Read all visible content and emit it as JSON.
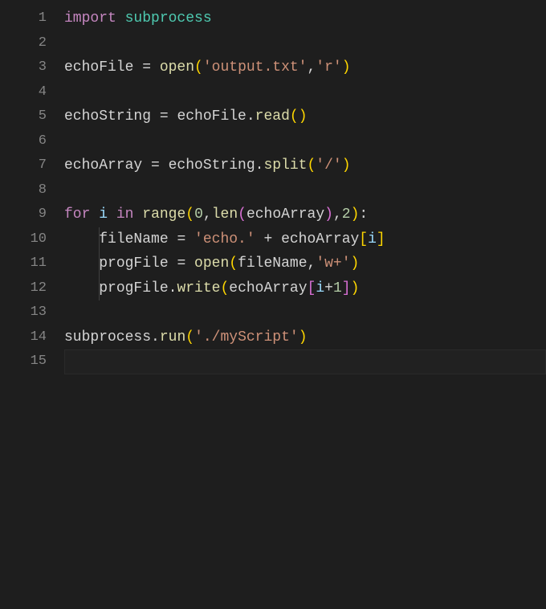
{
  "editor": {
    "language": "python",
    "current_line": 15,
    "lines": [
      {
        "num": 1,
        "indent": 0,
        "tokens": [
          {
            "t": "import ",
            "c": "tk-kw"
          },
          {
            "t": "subprocess",
            "c": "tk-mod"
          }
        ]
      },
      {
        "num": 2,
        "indent": 0,
        "tokens": []
      },
      {
        "num": 3,
        "indent": 0,
        "tokens": [
          {
            "t": "echoFile",
            "c": "tk-ident"
          },
          {
            "t": " = ",
            "c": "tk-op"
          },
          {
            "t": "open",
            "c": "tk-builtin"
          },
          {
            "t": "(",
            "c": "tk-par"
          },
          {
            "t": "'output.txt'",
            "c": "tk-str"
          },
          {
            "t": ",",
            "c": "tk-punc"
          },
          {
            "t": "'r'",
            "c": "tk-str"
          },
          {
            "t": ")",
            "c": "tk-par"
          }
        ]
      },
      {
        "num": 4,
        "indent": 0,
        "tokens": []
      },
      {
        "num": 5,
        "indent": 0,
        "tokens": [
          {
            "t": "echoString",
            "c": "tk-ident"
          },
          {
            "t": " = ",
            "c": "tk-op"
          },
          {
            "t": "echoFile",
            "c": "tk-ident"
          },
          {
            "t": ".",
            "c": "tk-op"
          },
          {
            "t": "read",
            "c": "tk-func"
          },
          {
            "t": "(",
            "c": "tk-par"
          },
          {
            "t": ")",
            "c": "tk-par"
          }
        ]
      },
      {
        "num": 6,
        "indent": 0,
        "tokens": []
      },
      {
        "num": 7,
        "indent": 0,
        "tokens": [
          {
            "t": "echoArray",
            "c": "tk-ident"
          },
          {
            "t": " = ",
            "c": "tk-op"
          },
          {
            "t": "echoString",
            "c": "tk-ident"
          },
          {
            "t": ".",
            "c": "tk-op"
          },
          {
            "t": "split",
            "c": "tk-func"
          },
          {
            "t": "(",
            "c": "tk-par"
          },
          {
            "t": "'/'",
            "c": "tk-str"
          },
          {
            "t": ")",
            "c": "tk-par"
          }
        ]
      },
      {
        "num": 8,
        "indent": 0,
        "tokens": []
      },
      {
        "num": 9,
        "indent": 0,
        "tokens": [
          {
            "t": "for",
            "c": "tk-kw"
          },
          {
            "t": " ",
            "c": "tk-op"
          },
          {
            "t": "i",
            "c": "tk-var"
          },
          {
            "t": " ",
            "c": "tk-op"
          },
          {
            "t": "in",
            "c": "tk-kw"
          },
          {
            "t": " ",
            "c": "tk-op"
          },
          {
            "t": "range",
            "c": "tk-builtin"
          },
          {
            "t": "(",
            "c": "tk-par"
          },
          {
            "t": "0",
            "c": "tk-num"
          },
          {
            "t": ",",
            "c": "tk-punc"
          },
          {
            "t": "len",
            "c": "tk-builtin"
          },
          {
            "t": "(",
            "c": "tk-par2"
          },
          {
            "t": "echoArray",
            "c": "tk-ident"
          },
          {
            "t": ")",
            "c": "tk-par2"
          },
          {
            "t": ",",
            "c": "tk-punc"
          },
          {
            "t": "2",
            "c": "tk-num"
          },
          {
            "t": ")",
            "c": "tk-par"
          },
          {
            "t": ":",
            "c": "tk-punc"
          }
        ]
      },
      {
        "num": 10,
        "indent": 1,
        "guide": true,
        "tokens": [
          {
            "t": "fileName",
            "c": "tk-ident"
          },
          {
            "t": " = ",
            "c": "tk-op"
          },
          {
            "t": "'echo.'",
            "c": "tk-str"
          },
          {
            "t": " + ",
            "c": "tk-op"
          },
          {
            "t": "echoArray",
            "c": "tk-ident"
          },
          {
            "t": "[",
            "c": "tk-par"
          },
          {
            "t": "i",
            "c": "tk-var"
          },
          {
            "t": "]",
            "c": "tk-par"
          }
        ]
      },
      {
        "num": 11,
        "indent": 1,
        "guide": true,
        "tokens": [
          {
            "t": "progFile",
            "c": "tk-ident"
          },
          {
            "t": " = ",
            "c": "tk-op"
          },
          {
            "t": "open",
            "c": "tk-builtin"
          },
          {
            "t": "(",
            "c": "tk-par"
          },
          {
            "t": "fileName",
            "c": "tk-ident"
          },
          {
            "t": ",",
            "c": "tk-punc"
          },
          {
            "t": "'w+'",
            "c": "tk-str"
          },
          {
            "t": ")",
            "c": "tk-par"
          }
        ]
      },
      {
        "num": 12,
        "indent": 1,
        "guide": true,
        "tokens": [
          {
            "t": "progFile",
            "c": "tk-ident"
          },
          {
            "t": ".",
            "c": "tk-op"
          },
          {
            "t": "write",
            "c": "tk-func"
          },
          {
            "t": "(",
            "c": "tk-par"
          },
          {
            "t": "echoArray",
            "c": "tk-ident"
          },
          {
            "t": "[",
            "c": "tk-par2"
          },
          {
            "t": "i",
            "c": "tk-var"
          },
          {
            "t": "+",
            "c": "tk-op"
          },
          {
            "t": "1",
            "c": "tk-num"
          },
          {
            "t": "]",
            "c": "tk-par2"
          },
          {
            "t": ")",
            "c": "tk-par"
          }
        ]
      },
      {
        "num": 13,
        "indent": 0,
        "tokens": []
      },
      {
        "num": 14,
        "indent": 0,
        "tokens": [
          {
            "t": "subprocess",
            "c": "tk-ident"
          },
          {
            "t": ".",
            "c": "tk-op"
          },
          {
            "t": "run",
            "c": "tk-func"
          },
          {
            "t": "(",
            "c": "tk-par"
          },
          {
            "t": "'./myScript'",
            "c": "tk-str"
          },
          {
            "t": ")",
            "c": "tk-par"
          }
        ]
      },
      {
        "num": 15,
        "indent": 0,
        "tokens": []
      }
    ]
  }
}
